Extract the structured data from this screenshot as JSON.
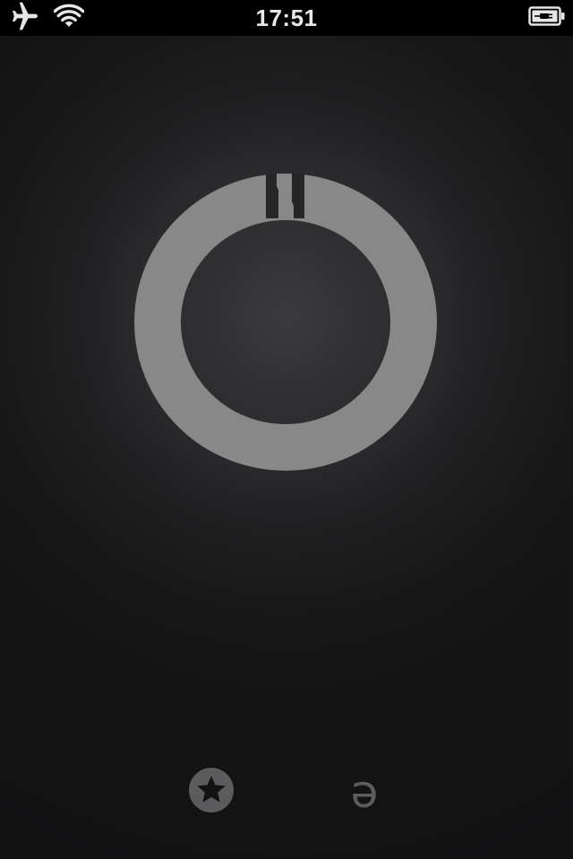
{
  "status_bar": {
    "time": "17:51",
    "left_icons": [
      "airplane-icon",
      "wifi-icon"
    ],
    "right_icons": [
      "battery-charging-icon"
    ]
  },
  "compass": {
    "north_label": "N",
    "ring_color": "#888889",
    "letter_color": "#262628",
    "glow_color": "#3b3b3d"
  },
  "bottom_bar": {
    "buttons": [
      {
        "icon": "star-ring-icon",
        "label": ""
      },
      {
        "icon": "schwa-icon",
        "glyph": "ə"
      }
    ],
    "icon_color": "#5c5c5e"
  },
  "colors": {
    "background": "#141415",
    "status_bar_bg": "#000000",
    "status_text": "#e8e8e8"
  }
}
